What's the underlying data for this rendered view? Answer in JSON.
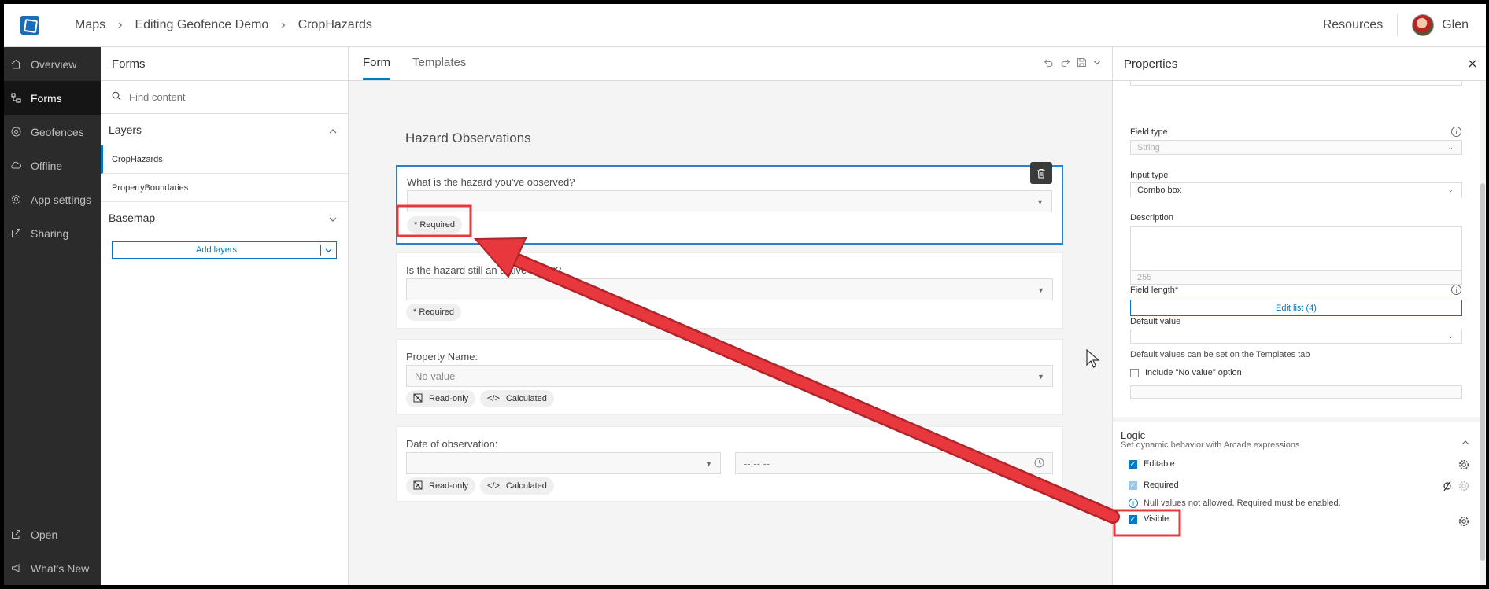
{
  "header": {
    "breadcrumbs": [
      "Maps",
      "Editing Geofence Demo",
      "CropHazards"
    ],
    "resources": "Resources",
    "user_name": "Glen"
  },
  "nav": {
    "items": [
      {
        "label": "Overview",
        "icon": "home-icon"
      },
      {
        "label": "Forms",
        "icon": "forms-icon"
      },
      {
        "label": "Geofences",
        "icon": "geofence-icon"
      },
      {
        "label": "Offline",
        "icon": "offline-icon"
      },
      {
        "label": "App settings",
        "icon": "gear-icon"
      },
      {
        "label": "Sharing",
        "icon": "share-icon"
      }
    ],
    "bottom": [
      {
        "label": "Open",
        "icon": "open-icon"
      },
      {
        "label": "What's New",
        "icon": "megaphone-icon"
      }
    ]
  },
  "forms_panel": {
    "title": "Forms",
    "search_placeholder": "Find content",
    "layers_title": "Layers",
    "layers": [
      "CropHazards",
      "PropertyBoundaries"
    ],
    "basemap_title": "Basemap",
    "add_layers": "Add layers"
  },
  "center": {
    "tabs": [
      "Form",
      "Templates"
    ],
    "form_title": "Hazard Observations",
    "fields": [
      {
        "label": "What is the hazard you've observed?",
        "value": "",
        "chips": [
          "* Required"
        ]
      },
      {
        "label": "Is the hazard still an active threat?",
        "value": "",
        "chips": [
          "* Required"
        ]
      },
      {
        "label": "Property Name:",
        "value": "No value",
        "chips": [
          "Read-only",
          "Calculated"
        ]
      },
      {
        "label": "Date of observation:",
        "value": "",
        "time_placeholder": "--:-- --",
        "chips": [
          "Read-only",
          "Calculated"
        ]
      }
    ]
  },
  "properties": {
    "title": "Properties",
    "field_type_label": "Field type",
    "field_type_value": "String",
    "input_type_label": "Input type",
    "input_type_value": "Combo box",
    "description_label": "Description",
    "field_length_label": "Field length*",
    "field_length_value": "255",
    "edit_list": "Edit list (4)",
    "default_value_label": "Default value",
    "default_hint": "Default values can be set on the Templates tab",
    "include_no_value": "Include \"No value\" option",
    "logic": {
      "title": "Logic",
      "subtitle": "Set dynamic behavior with Arcade expressions",
      "editable": "Editable",
      "required": "Required",
      "required_note": "Null values not allowed. Required must be enabled.",
      "visible": "Visible"
    }
  },
  "colors": {
    "accent": "#007ac2",
    "annotation": "#e8383d",
    "nav_bg": "#2b2b2b"
  }
}
